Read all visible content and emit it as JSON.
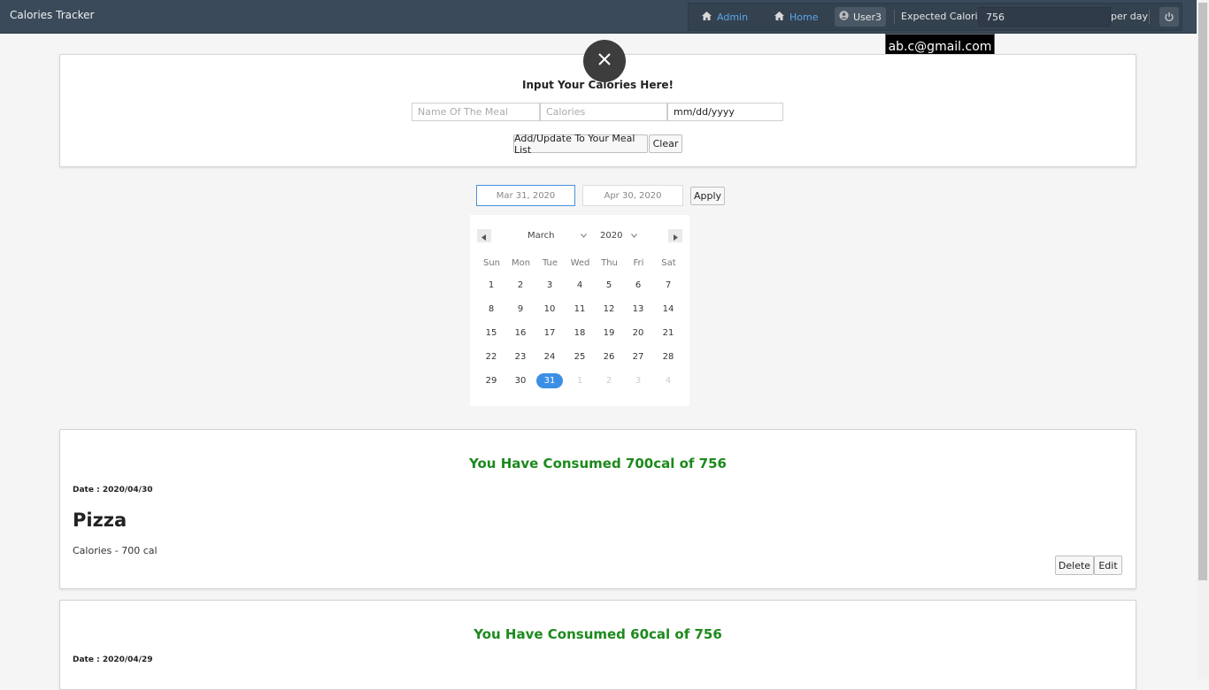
{
  "app": {
    "title": "Calories Tracker"
  },
  "nav": {
    "admin": "Admin",
    "home": "Home",
    "user": "User3",
    "expected_label": "Expected Calories",
    "expected_value": "756",
    "per_day": "per day",
    "tooltip_email": "ab.c@gmail.com"
  },
  "input_form": {
    "title": "Input Your Calories Here!",
    "meal_placeholder": "Name Of The Meal",
    "calories_placeholder": "Calories",
    "date_placeholder": "mm/dd/yyyy",
    "add_button": "Add/Update To Your Meal List",
    "clear_button": "Clear"
  },
  "date_range": {
    "start": "Mar 31, 2020",
    "end": "Apr 30, 2020",
    "apply": "Apply"
  },
  "calendar": {
    "month": "March",
    "year": "2020",
    "weekdays": [
      "Sun",
      "Mon",
      "Tue",
      "Wed",
      "Thu",
      "Fri",
      "Sat"
    ],
    "weeks": [
      [
        "1",
        "2",
        "3",
        "4",
        "5",
        "6",
        "7"
      ],
      [
        "8",
        "9",
        "10",
        "11",
        "12",
        "13",
        "14"
      ],
      [
        "15",
        "16",
        "17",
        "18",
        "19",
        "20",
        "21"
      ],
      [
        "22",
        "23",
        "24",
        "25",
        "26",
        "27",
        "28"
      ],
      [
        "29",
        "30",
        "31",
        "1",
        "2",
        "3",
        "4"
      ]
    ],
    "selected": "31",
    "accent_color": "#3b8fe5"
  },
  "entries": [
    {
      "consumed": "You Have Consumed 700cal of 756",
      "date": "Date : 2020/04/30",
      "meal": "Pizza",
      "calories": "Calories - 700 cal",
      "delete": "Delete",
      "edit": "Edit"
    },
    {
      "consumed": "You Have Consumed 60cal of 756",
      "date": "Date : 2020/04/29"
    }
  ],
  "colors": {
    "topbar": "#3a4a5a",
    "consumed_text": "#1c8a1c",
    "link": "#5aa8e8"
  }
}
